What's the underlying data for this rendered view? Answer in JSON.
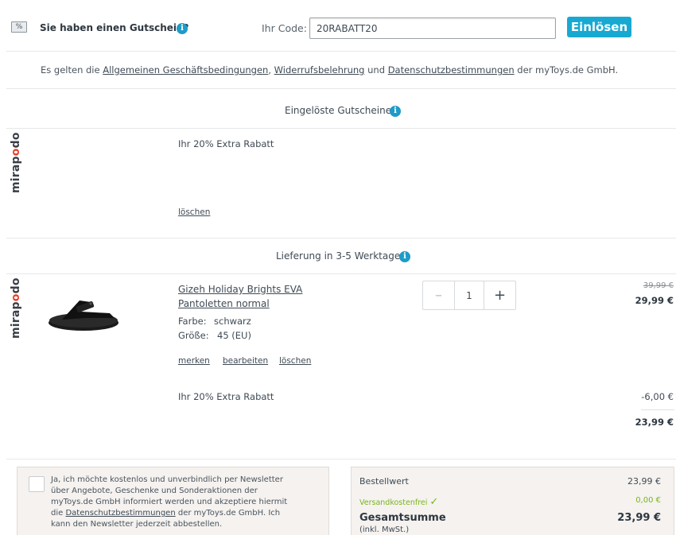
{
  "voucher": {
    "icon_text": "%",
    "question": "Sie haben einen Gutschein?",
    "code_label": "Ihr Code:",
    "code_value": "20RABATT20",
    "redeem_label": "Einlösen"
  },
  "terms": {
    "prefix": "Es gelten die ",
    "agb": "Allgemeinen Geschäftsbedingungen",
    "sep1": ", ",
    "widerruf": "Widerrufsbelehrung",
    "mid": " und ",
    "datenschutz": "Datenschutzbestimmungen",
    "suffix": " der myToys.de GmbH."
  },
  "redeemed": {
    "heading": "Eingelöste Gutscheine:",
    "voucher_name": "Ihr 20% Extra Rabatt",
    "delete_label": "löschen"
  },
  "brand": {
    "part1": "mirap",
    "o": "o",
    "part2": "do"
  },
  "delivery": {
    "heading": "Lieferung in 3-5 Werktagen"
  },
  "item": {
    "name_line1": "Gizeh Holiday Brights EVA",
    "name_line2": "Pantoletten normal",
    "color_label": "Farbe:",
    "color_value": "schwarz",
    "size_label": "Größe:",
    "size_value": "45 (EU)",
    "action_remember": "merken",
    "action_edit": "bearbeiten",
    "action_delete": "löschen",
    "quantity": "1",
    "old_price": "39,99 €",
    "price": "29,99 €",
    "discount_label": "Ihr 20% Extra Rabatt",
    "discount_value": "-6,00 €",
    "subtotal": "23,99 €"
  },
  "newsletter": {
    "text_pre": "Ja, ich möchte kostenlos und unverbindlich per Newsletter über Angebote, Geschenke und Sonderaktionen der myToys.de GmbH informiert werden und akzeptiere hiermit die ",
    "link": "Datenschutzbestimmungen",
    "text_post": " der myToys.de GmbH. Ich kann den Newsletter jederzeit abbestellen."
  },
  "summary": {
    "order_value_label": "Bestellwert",
    "order_value": "23,99 €",
    "shipping_label": "Versandkostenfrei",
    "shipping_value": "0,00 €",
    "total_label": "Gesamtsumme",
    "total_note": "(inkl. MwSt.)",
    "total_value": "23,99 €"
  },
  "colors": {
    "accent": "#17a9d1",
    "info": "#1e9bc9",
    "green": "#7ab51d",
    "brand_o": "#e5412d"
  }
}
